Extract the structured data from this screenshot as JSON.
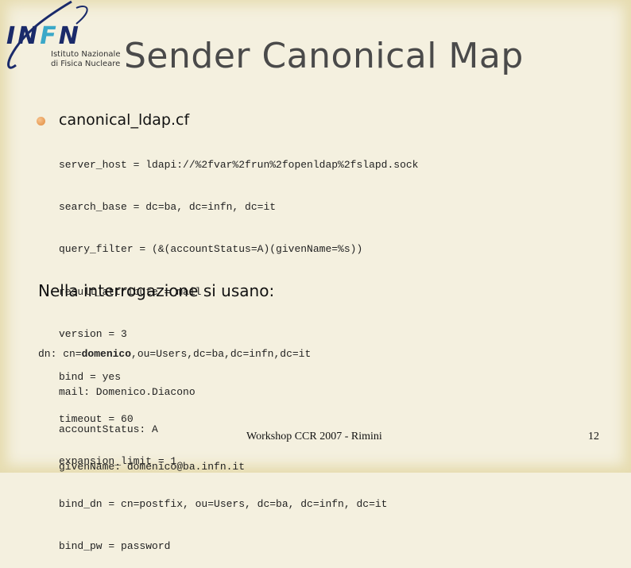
{
  "logo": {
    "name": "INFN",
    "subtitle_line1": "Istituto Nazionale",
    "subtitle_line2": "di Fisica Nucleare",
    "colors": {
      "navy": "#1a2a6a",
      "cyan": "#3aa8c8"
    }
  },
  "title": "Sender Canonical Map",
  "bullet": {
    "label": "canonical_ldap.cf",
    "icon": "orange-dot-bullet"
  },
  "config_lines": [
    "server_host = ldapi://%2fvar%2frun%2fopenldap%2fslapd.sock",
    "search_base = dc=ba, dc=infn, dc=it",
    "query_filter = (&(accountStatus=A)(givenName=%s))",
    "result_attribute = mail",
    "version = 3",
    "bind = yes",
    "timeout = 60",
    "expansion_limit = 1",
    "bind_dn = cn=postfix, ou=Users, dc=ba, dc=infn, dc=it",
    "bind_pw = password"
  ],
  "subheading": "Nella interrogazione si usano:",
  "ldap_entry": {
    "dn_prefix": "dn: cn=",
    "dn_bold": "domenico",
    "dn_suffix": ",ou=Users,dc=ba,dc=infn,dc=it",
    "attributes": [
      "mail: Domenico.Diacono",
      "accountStatus: A",
      "givenName: domenico@ba.infn.it"
    ]
  },
  "footer": {
    "text": "Workshop CCR 2007 - Rimini",
    "page_number": "12"
  }
}
